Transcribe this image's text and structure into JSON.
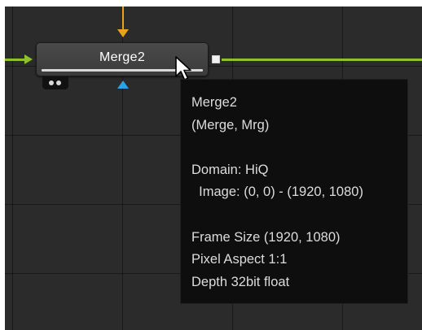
{
  "node": {
    "title": "Merge2"
  },
  "tooltip": {
    "name": "Merge2",
    "type": "(Merge, Mrg)",
    "domain": "Domain: HiQ",
    "image": "  Image: (0, 0) - (1920, 1080)",
    "frame_size": "Frame Size (1920, 1080)",
    "pixel_aspect": "Pixel Aspect 1:1",
    "depth": "Depth 32bit float"
  },
  "colors": {
    "canvas": "#2b2b2b",
    "foreground_link": "#8fc12a",
    "background_link": "#e8a31d",
    "mask_input": "#2ba3e6",
    "tooltip_bg": "#0e0e0e"
  },
  "icons": {
    "cursor": "arrow-pointer-icon",
    "output": "output-square-icon",
    "inputs": [
      "background-input-triangle-icon",
      "foreground-input-triangle-icon",
      "mask-input-triangle-icon"
    ]
  }
}
